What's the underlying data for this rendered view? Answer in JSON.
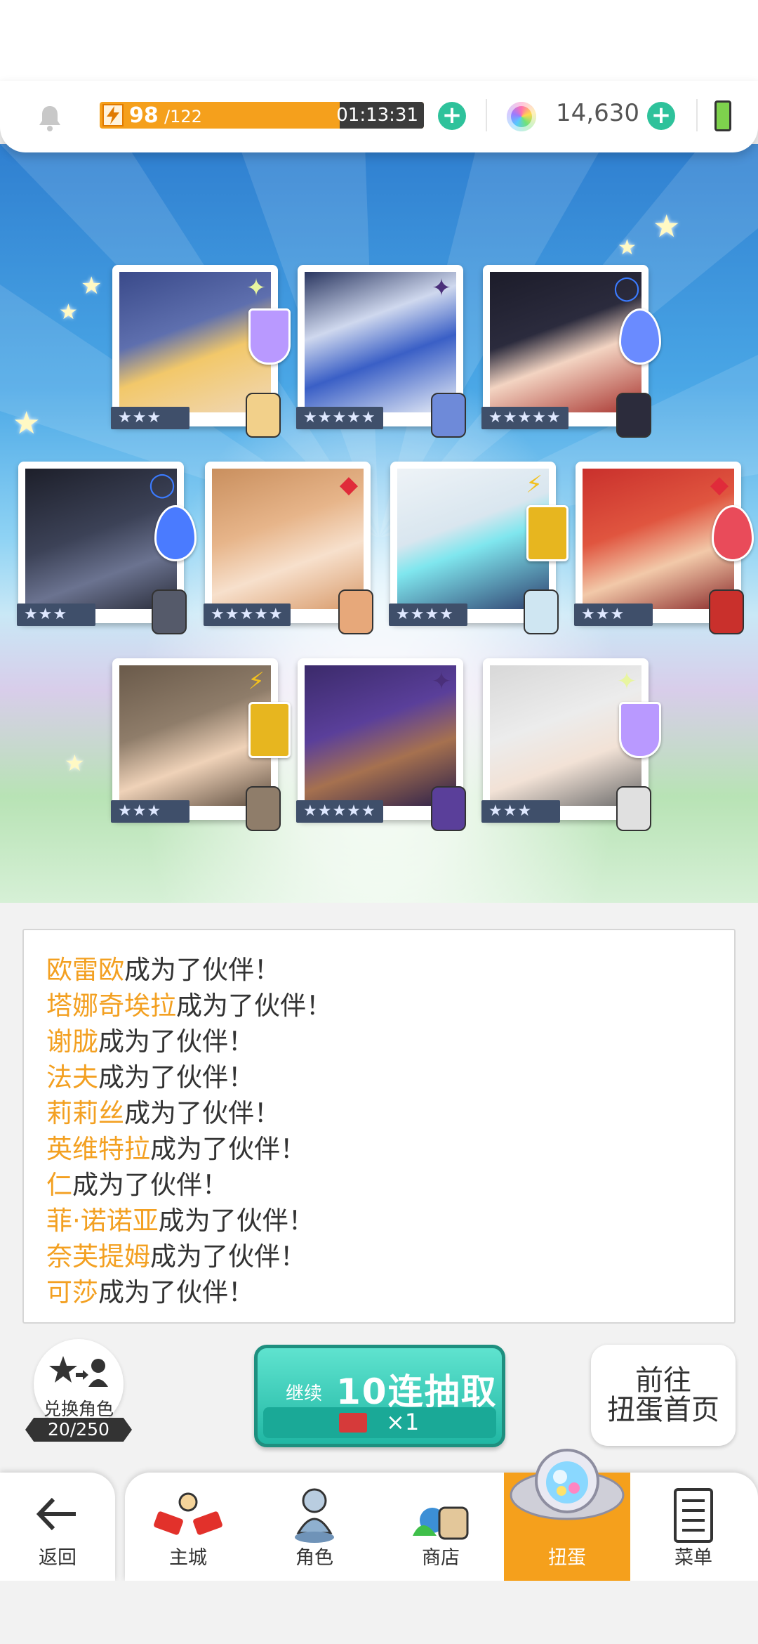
{
  "status_bar": {
    "energy_current": "98",
    "energy_max": "/122",
    "energy_progress": 0.8,
    "energy_timer_prefix": "01",
    "energy_timer": ":13:31",
    "gems": "14,630"
  },
  "cards": [
    {
      "stars": "★★★",
      "element": "light",
      "element_symbol": "✦",
      "crest_color": "#b999ff"
    },
    {
      "stars": "★★★★★",
      "element": "dark",
      "element_symbol": "✦",
      "crest_color": "#5b6bd6"
    },
    {
      "stars": "★★★★★",
      "element": "water",
      "element_symbol": "◯",
      "crest_color": "#6a8bff"
    },
    {
      "stars": "★★★",
      "element": "water",
      "element_symbol": "◯",
      "crest_color": "#4a7bff"
    },
    {
      "stars": "★★★★★",
      "element": "fire",
      "element_symbol": "◆",
      "crest_color": "#e94b5a"
    },
    {
      "stars": "★★★★",
      "element": "thunder",
      "element_symbol": "⚡",
      "crest_color": "#e7b61f"
    },
    {
      "stars": "★★★",
      "element": "fire",
      "element_symbol": "◆",
      "crest_color": "#e94b5a"
    },
    {
      "stars": "★★★",
      "element": "thunder",
      "element_symbol": "⚡",
      "crest_color": "#e7b61f"
    },
    {
      "stars": "★★★★★",
      "element": "dark",
      "element_symbol": "✦",
      "crest_color": "#5b6bd6"
    },
    {
      "stars": "★★★",
      "element": "light",
      "element_symbol": "✦",
      "crest_color": "#b999ff"
    }
  ],
  "log": {
    "suffix": "成为了伙伴！",
    "names": [
      "欧雷欧",
      "塔娜奇埃拉",
      "谢胧",
      "法夫",
      "莉莉丝",
      "英维特拉",
      "仁",
      "菲·诺诺亚",
      "奈芙提姆",
      "可莎"
    ]
  },
  "exchange": {
    "label": "兑换角色",
    "count": "20/250"
  },
  "pull_button": {
    "continue_label": "继续",
    "main_label": "10连抽取",
    "ticket_count": "×1"
  },
  "goto_button": {
    "line1": "前往",
    "line2": "扭蛋首页"
  },
  "nav": {
    "back": "返回",
    "items": [
      "主城",
      "角色",
      "商店",
      "扭蛋",
      "菜单"
    ],
    "active_index": 3
  },
  "colors": {
    "accent": "#f5a01c",
    "teal": "#2ec29b",
    "name_highlight": "#f3a021"
  }
}
